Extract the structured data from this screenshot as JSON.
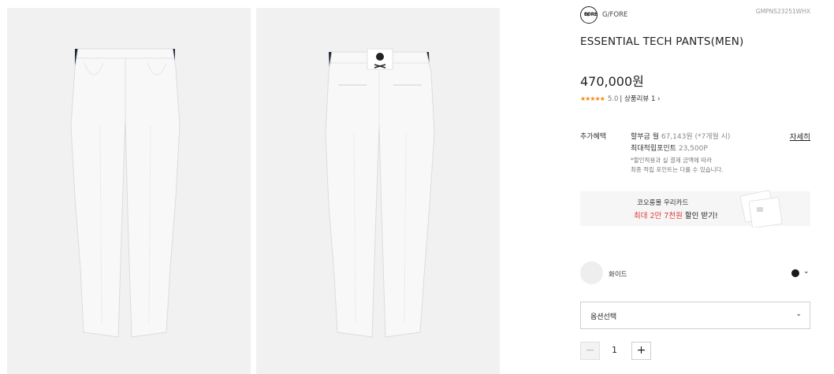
{
  "gallery": {
    "images": [
      {
        "name": "pants-front-view"
      },
      {
        "name": "pants-back-view"
      }
    ]
  },
  "brand": {
    "logo_text_line1": "G/",
    "logo_text_line2": "FORE",
    "name": "G/FORE"
  },
  "product": {
    "code": "GMPNS23251WHX",
    "title": "ESSENTIAL TECH PANTS(MEN)",
    "price": "470,000원"
  },
  "review": {
    "stars": "★★★★★",
    "rating": "5.0",
    "link": "| 상품리뷰 1 ›"
  },
  "benefits": {
    "label": "추가혜택",
    "installment_label": "할부금 월",
    "installment_value": "67,143원 (*7개월 시)",
    "points_label": "최대적립포인트",
    "points_value": "23,500P",
    "detail_link": "자세히",
    "notice_line1": "*할인적용과 실 결제 금액에 따라",
    "notice_line2": "최종 적립 포인트는 다를 수 있습니다."
  },
  "card_banner": {
    "title": "코오롱몰 우리카드",
    "promo_accent": "최대 2만 7천원",
    "promo_rest": " 할인 받기!"
  },
  "color": {
    "selected_name": "화이드",
    "swatch_color": "#eeeeee",
    "alt_swatch_color": "#1a1a1a"
  },
  "option_select": {
    "label": "옵션선택"
  },
  "quantity": {
    "minus": "−",
    "value": "1",
    "plus": "+"
  }
}
